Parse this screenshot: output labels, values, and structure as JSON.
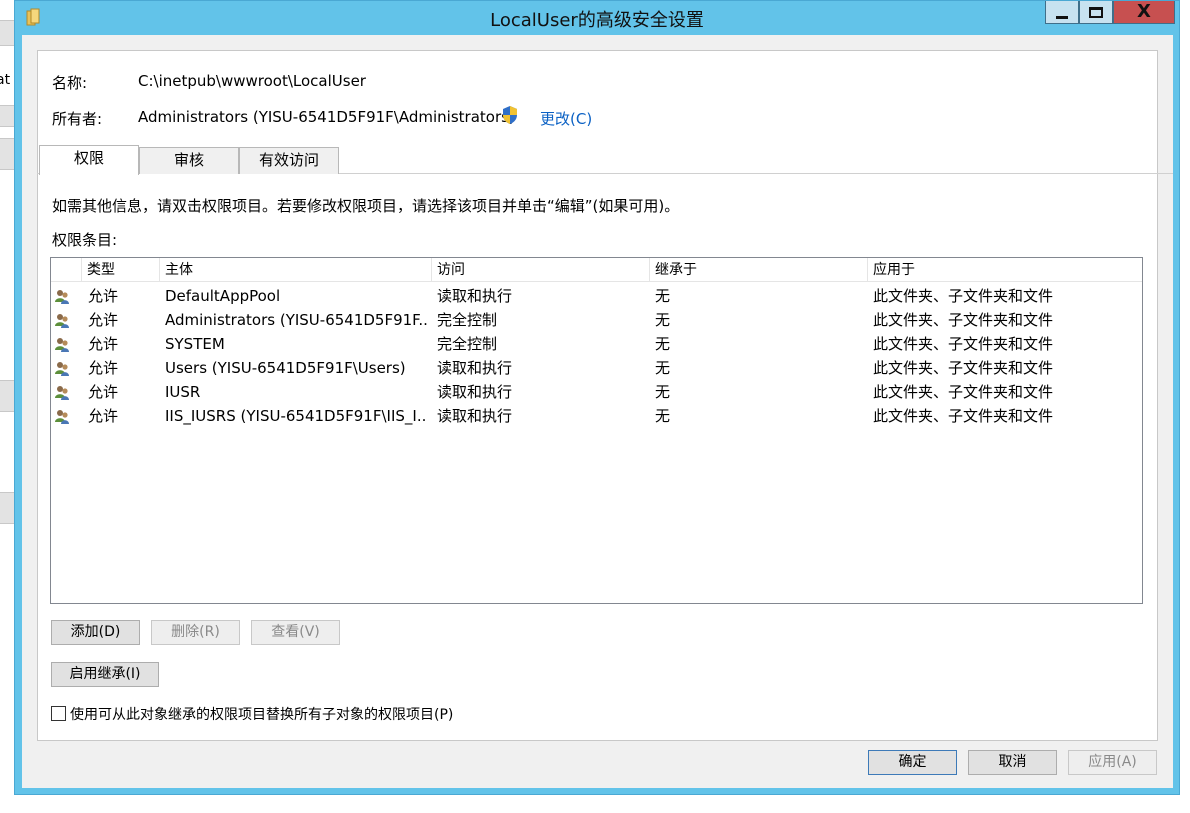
{
  "background_window": {
    "partial_text": "at"
  },
  "window": {
    "title": "LocalUser的高级安全设置",
    "controls": {
      "close": "X"
    }
  },
  "info": {
    "name_label": "名称:",
    "name_value": "C:\\inetpub\\wwwroot\\LocalUser",
    "owner_label": "所有者:",
    "owner_value": "Administrators (YISU-6541D5F91F\\Administrators)",
    "change_link": "更改(C)"
  },
  "tabs": [
    {
      "label": "权限",
      "active": true
    },
    {
      "label": "审核",
      "active": false
    },
    {
      "label": "有效访问",
      "active": false
    }
  ],
  "instructions": "如需其他信息，请双击权限项目。若要修改权限项目，请选择该项目并单击“编辑”(如果可用)。",
  "entries_label": "权限条目:",
  "table": {
    "columns": [
      "类型",
      "主体",
      "访问",
      "继承于",
      "应用于"
    ],
    "rows": [
      {
        "type": "允许",
        "principal": "DefaultAppPool",
        "access": "读取和执行",
        "inherited": "无",
        "applies": "此文件夹、子文件夹和文件"
      },
      {
        "type": "允许",
        "principal": "Administrators (YISU-6541D5F91F...",
        "access": "完全控制",
        "inherited": "无",
        "applies": "此文件夹、子文件夹和文件"
      },
      {
        "type": "允许",
        "principal": "SYSTEM",
        "access": "完全控制",
        "inherited": "无",
        "applies": "此文件夹、子文件夹和文件"
      },
      {
        "type": "允许",
        "principal": "Users (YISU-6541D5F91F\\Users)",
        "access": "读取和执行",
        "inherited": "无",
        "applies": "此文件夹、子文件夹和文件"
      },
      {
        "type": "允许",
        "principal": "IUSR",
        "access": "读取和执行",
        "inherited": "无",
        "applies": "此文件夹、子文件夹和文件"
      },
      {
        "type": "允许",
        "principal": "IIS_IUSRS (YISU-6541D5F91F\\IIS_I...",
        "access": "读取和执行",
        "inherited": "无",
        "applies": "此文件夹、子文件夹和文件"
      }
    ]
  },
  "buttons": {
    "add": "添加(D)",
    "remove": "删除(R)",
    "view": "查看(V)",
    "enable_inheritance": "启用继承(I)"
  },
  "replace_checkbox": {
    "label": "使用可从此对象继承的权限项目替换所有子对象的权限项目(P)",
    "checked": false
  },
  "footer": {
    "ok": "确定",
    "cancel": "取消",
    "apply": "应用(A)"
  }
}
